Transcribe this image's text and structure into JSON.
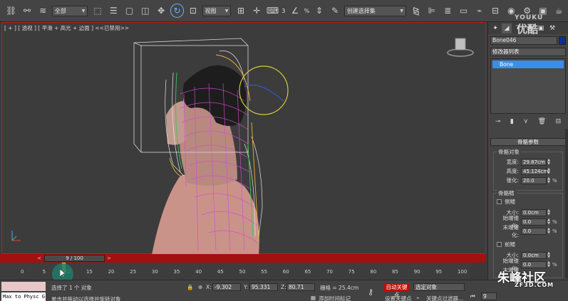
{
  "toolbar": {
    "selection_filter": "全部",
    "ref_coord": "视图",
    "named_selection": "创建选择集",
    "snap_count": "3",
    "percent": "%"
  },
  "viewport": {
    "label": "[ + ] [ 透视 ] [ 平滑 + 高光 + 边面 ] <<已禁用>>"
  },
  "timeslider": {
    "frame": "9 / 100",
    "left_arrow": "<",
    "right_arrow": ">"
  },
  "ruler": {
    "ticks": [
      "0",
      "5",
      "10",
      "15",
      "20",
      "25",
      "30",
      "35",
      "40",
      "45",
      "50",
      "55",
      "60",
      "65",
      "70",
      "75",
      "80",
      "85",
      "90",
      "95",
      "100"
    ]
  },
  "status": {
    "maxscript": "Max to Physc G",
    "selected": "选择了 1 个 对象",
    "prompt": "单击并拖动以选择并旋转对象",
    "x_label": "X:",
    "x_val": "-9.302",
    "y_label": "Y:",
    "y_val": "95.331",
    "z_label": "Z:",
    "z_val": "80.71",
    "grid": "栅格 = 25.4cm",
    "add_tag": "添加时间标记",
    "autokey": "自动关键点",
    "setkey": "设置关键点",
    "selected_obj": "选定对象",
    "key_filter": "关键点过滤器...",
    "frame_field": "9"
  },
  "panel": {
    "object_name": "Bone046",
    "object_color": "#0f2f8f",
    "modifier_list": "修改器列表",
    "stack_item": "Bone",
    "rollout_title": "骨骼参数",
    "bone_object_group": "骨骼对象",
    "width_label": "宽度:",
    "width_val": "29.87cm",
    "height_label": "高度:",
    "height_val": "45.124cm",
    "taper_label": "锥化:",
    "taper_val": "20.0",
    "fins_group": "骨骼鳍",
    "side_fins": "侧鳍",
    "size_label": "大小:",
    "size_val": "0.0cm",
    "start_taper_label": "始端锥化:",
    "start_taper_val": "0.0",
    "end_taper_label": "末端锥化:",
    "end_taper_val": "0.0",
    "front_fin": "前鳍",
    "front_size_val": "0.0cm",
    "front_start_val": "0.0",
    "front_end_label": "末端锥化:",
    "pct": "%"
  },
  "watermarks": {
    "youku_en": "YOUKU",
    "youku_cn": "优酷",
    "zf_cn": "朱峰社区",
    "zf_en": "ZF3D.COM"
  }
}
